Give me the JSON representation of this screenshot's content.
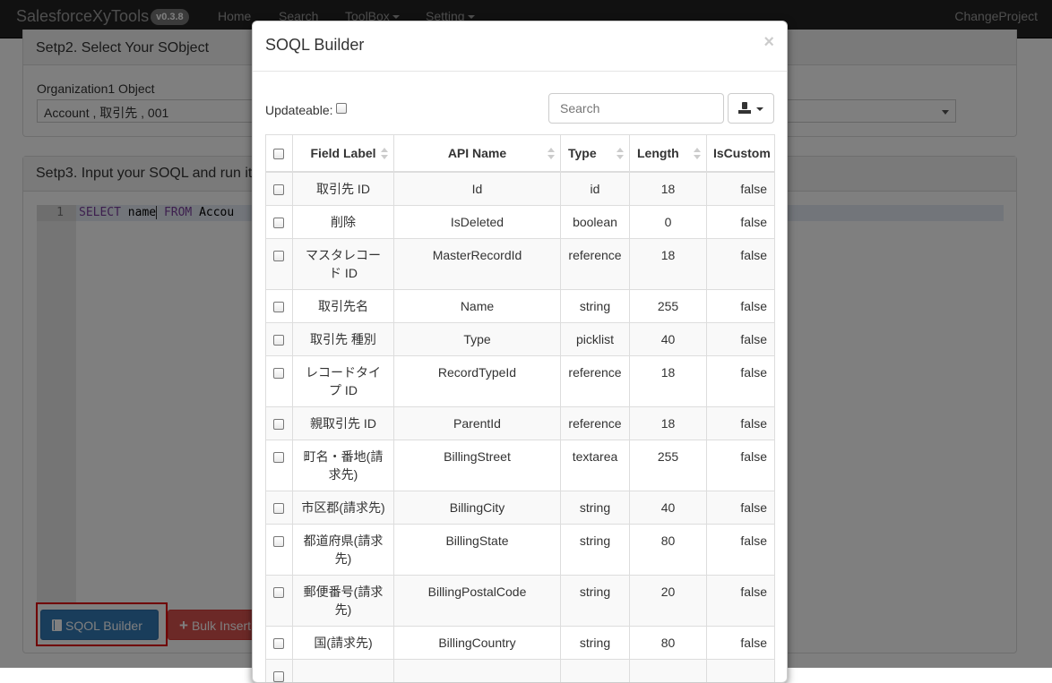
{
  "navbar": {
    "brand": "SalesforceXyTools",
    "version": "v0.3.8",
    "home": "Home",
    "search": "Search",
    "toolbox": "ToolBox",
    "setting": "Setting",
    "change_project": "ChangeProject"
  },
  "step2": {
    "title": "Setp2. Select Your SObject",
    "org_label": "Organization1 Object",
    "org_selected": "Account , 取引先 , 001"
  },
  "step3": {
    "title": "Setp3. Input your SOQL and run it",
    "line_number": "1",
    "code": {
      "kw1": "SELECT",
      "field": "name",
      "kw2": "FROM",
      "obj": "Accou"
    },
    "soql_builder_label": "SQOL Builder",
    "bulk_insert_label": "Bulk Insert"
  },
  "modal": {
    "title": "SOQL Builder",
    "close": "×",
    "updateable_label": "Updateable:",
    "search_placeholder": "Search",
    "columns": [
      "Field Label",
      "API Name",
      "Type",
      "Length",
      "IsCustom"
    ],
    "rows": [
      {
        "label": "取引先 ID",
        "api": "Id",
        "type": "id",
        "length": "18",
        "custom": "false"
      },
      {
        "label": "削除",
        "api": "IsDeleted",
        "type": "boolean",
        "length": "0",
        "custom": "false"
      },
      {
        "label": "マスタレコード ID",
        "api": "MasterRecordId",
        "type": "reference",
        "length": "18",
        "custom": "false"
      },
      {
        "label": "取引先名",
        "api": "Name",
        "type": "string",
        "length": "255",
        "custom": "false"
      },
      {
        "label": "取引先 種別",
        "api": "Type",
        "type": "picklist",
        "length": "40",
        "custom": "false"
      },
      {
        "label": "レコードタイプ ID",
        "api": "RecordTypeId",
        "type": "reference",
        "length": "18",
        "custom": "false"
      },
      {
        "label": "親取引先 ID",
        "api": "ParentId",
        "type": "reference",
        "length": "18",
        "custom": "false"
      },
      {
        "label": "町名・番地(請求先)",
        "api": "BillingStreet",
        "type": "textarea",
        "length": "255",
        "custom": "false"
      },
      {
        "label": "市区郡(請求先)",
        "api": "BillingCity",
        "type": "string",
        "length": "40",
        "custom": "false"
      },
      {
        "label": "都道府県(請求先)",
        "api": "BillingState",
        "type": "string",
        "length": "80",
        "custom": "false"
      },
      {
        "label": "郵便番号(請求先)",
        "api": "BillingPostalCode",
        "type": "string",
        "length": "20",
        "custom": "false"
      },
      {
        "label": "国(請求先)",
        "api": "BillingCountry",
        "type": "string",
        "length": "80",
        "custom": "false"
      }
    ]
  },
  "colors": {
    "navbar_bg": "#222222",
    "primary": "#337ab7",
    "danger": "#d9534f",
    "highlight": "#e00000"
  },
  "icons": [
    "book-icon",
    "plus-icon",
    "export-icon",
    "close-icon",
    "sort-icon",
    "chevron-down-icon"
  ]
}
